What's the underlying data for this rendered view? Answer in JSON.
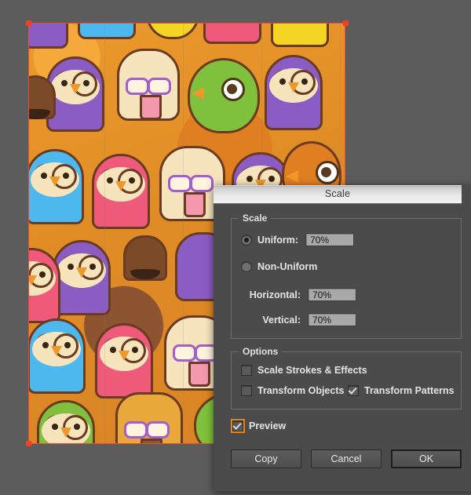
{
  "canvas": {
    "background_color": "#5c5c5c",
    "artwork": {
      "name": "cartoon-animal-pattern-artwork",
      "description": "Repeating vector pattern of cartoon owls, birds, cats with glasses and green monsters on an orange background",
      "selection_color": "#ee4b33",
      "handle_color": "#f04124",
      "palette": [
        "#8a5cc4",
        "#4cb8ee",
        "#ef5a7a",
        "#f5d523",
        "#7fc13c",
        "#e8922a",
        "#f6e4bd",
        "#6b3a22"
      ]
    }
  },
  "dialog": {
    "title": "Scale",
    "groups": {
      "scale": {
        "label": "Scale",
        "uniform": {
          "label": "Uniform:",
          "selected": true,
          "value": "70%"
        },
        "non_uniform": {
          "label": "Non-Uniform",
          "selected": false
        },
        "horizontal": {
          "label": "Horizontal:",
          "value": "70%"
        },
        "vertical": {
          "label": "Vertical:",
          "value": "70%"
        }
      },
      "options": {
        "label": "Options",
        "scale_strokes_effects": {
          "label": "Scale Strokes & Effects",
          "checked": false
        },
        "transform_objects": {
          "label": "Transform Objects",
          "checked": false
        },
        "transform_patterns": {
          "label": "Transform Patterns",
          "checked": true
        }
      }
    },
    "preview": {
      "label": "Preview",
      "checked": true,
      "focus_ring_color": "#e2861f"
    },
    "buttons": {
      "copy": "Copy",
      "cancel": "Cancel",
      "ok": "OK",
      "default": "OK"
    }
  }
}
